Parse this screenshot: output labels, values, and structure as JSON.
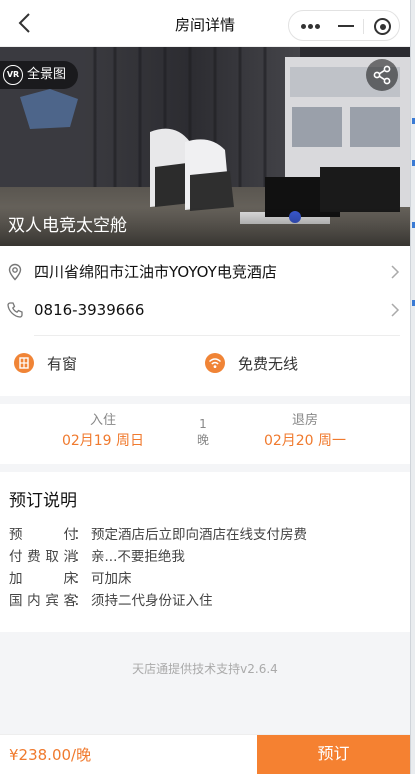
{
  "nav": {
    "title": "房间详情"
  },
  "hero": {
    "vr_label": "全景图",
    "vr_badge_text": "VR",
    "room_name": "双人电竞太空舱"
  },
  "info": {
    "address": "四川省绵阳市江油市YOYOY电竞酒店",
    "phone": "0816-3939666",
    "features": [
      {
        "label": "有窗",
        "icon": "window-icon"
      },
      {
        "label": "免费无线",
        "icon": "wifi-icon"
      }
    ]
  },
  "dates": {
    "checkin_label": "入住",
    "checkin_value": "02月19 周日",
    "nights_count": "1",
    "nights_unit": "晚",
    "checkout_label": "退房",
    "checkout_value": "02月20 周一"
  },
  "booking_notes": {
    "title": "预订说明",
    "rows": [
      {
        "key": "预付",
        "value": "预定酒店后立即向酒店在线支付房费"
      },
      {
        "key": "付费取消",
        "value": "亲...不要拒绝我"
      },
      {
        "key": "加床",
        "value": "可加床"
      },
      {
        "key": "国内宾客",
        "value": "须持二代身份证入住"
      }
    ]
  },
  "footer": {
    "note": "天店通提供技术支持v2.6.4"
  },
  "bottom_bar": {
    "price": "¥238.00/晚",
    "book_label": "预订"
  },
  "colors": {
    "accent": "#f58131",
    "accent_text": "#f07a2e",
    "page_bg": "#f4f5f7"
  }
}
